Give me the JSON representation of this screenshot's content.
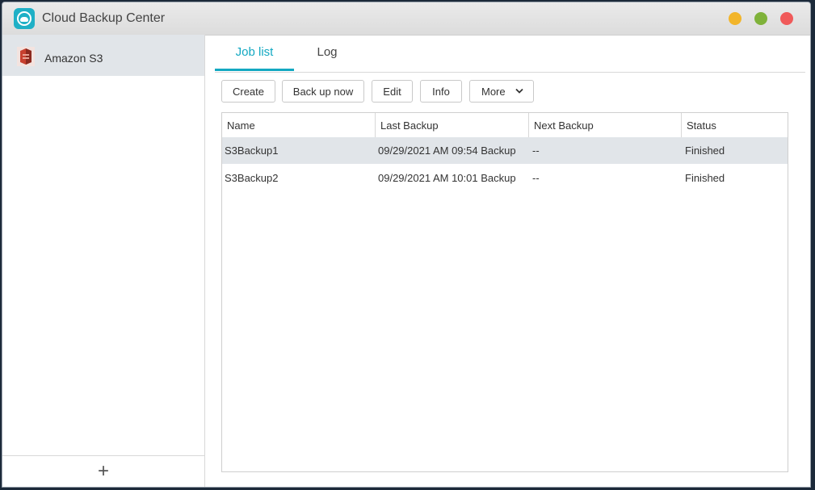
{
  "window": {
    "title": "Cloud Backup Center"
  },
  "sidebar": {
    "items": [
      {
        "label": "Amazon S3",
        "icon": "amazon-s3-icon"
      }
    ],
    "add_label": "+"
  },
  "tabs": [
    {
      "label": "Job list",
      "active": true
    },
    {
      "label": "Log",
      "active": false
    }
  ],
  "toolbar": {
    "create": "Create",
    "backup_now": "Back up now",
    "edit": "Edit",
    "info": "Info",
    "more": "More"
  },
  "table": {
    "columns": [
      "Name",
      "Last Backup",
      "Next Backup",
      "Status"
    ],
    "rows": [
      {
        "name": "S3Backup1",
        "last_backup": "09/29/2021 AM 09:54 Backup",
        "next_backup": "--",
        "status": "Finished",
        "selected": true
      },
      {
        "name": "S3Backup2",
        "last_backup": "09/29/2021 AM 10:01 Backup",
        "next_backup": "--",
        "status": "Finished",
        "selected": false
      }
    ]
  },
  "colors": {
    "accent": "#13a8c2",
    "selected_row": "#e1e5e9",
    "minimize": "#f2b52a",
    "maximize": "#7fb23a",
    "close": "#f05a5a"
  }
}
